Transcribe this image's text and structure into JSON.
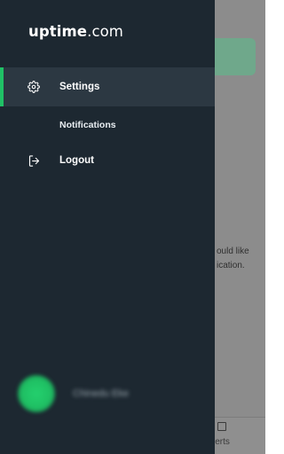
{
  "background": {
    "line1": "ould like",
    "line2": "ication.",
    "bottom_tab_label": "lerts"
  },
  "drawer": {
    "logo": {
      "brand": "uptime",
      "tld": ".com"
    },
    "items": [
      {
        "label": "Settings",
        "icon": "gear-icon",
        "active": true
      },
      {
        "label": "Notifications",
        "icon": "",
        "active": false
      },
      {
        "label": "Logout",
        "icon": "logout-icon",
        "active": false
      }
    ],
    "user": {
      "name": "Chinedu Eke"
    }
  },
  "colors": {
    "drawer_bg": "#1d2831",
    "active_bg": "#2c3842",
    "accent": "#20c166"
  }
}
